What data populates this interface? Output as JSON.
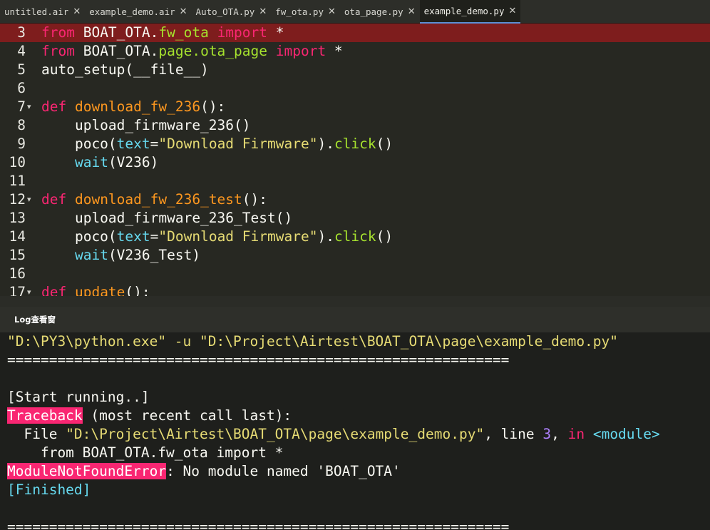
{
  "tabs": [
    {
      "label": "untitled.air",
      "active": false
    },
    {
      "label": "example_demo.air",
      "active": false
    },
    {
      "label": "Auto_OTA.py",
      "active": false
    },
    {
      "label": "fw_ota.py",
      "active": false
    },
    {
      "label": "ota_page.py",
      "active": false
    },
    {
      "label": "example_demo.py",
      "active": true
    }
  ],
  "close_glyph": "✕",
  "fold_glyph": "▾",
  "editor": {
    "lines": {
      "l3": {
        "num": "3",
        "t1": "from",
        "t2": " BOAT_OTA.",
        "t3": "fw_ota",
        "t4": " import",
        "t5": " *"
      },
      "l4": {
        "num": "4",
        "t1": "from",
        "t2": " BOAT_OTA.",
        "t3": "page.ota_page",
        "t4": " import",
        "t5": " *"
      },
      "l5": {
        "num": "5",
        "t1": "auto_setup(__file__)"
      },
      "l6": {
        "num": "6"
      },
      "l7": {
        "num": "7",
        "t1": "def",
        "t2": " download_fw_236",
        "t3": "():"
      },
      "l8": {
        "num": "8",
        "t1": "    upload_firmware_236()"
      },
      "l9": {
        "num": "9",
        "t1": "    poco(",
        "t2": "text",
        "t3": "=",
        "t4": "\"Download Firmware\"",
        "t5": ").",
        "t6": "click",
        "t7": "()"
      },
      "l10": {
        "num": "10",
        "t1": "    ",
        "t2": "wait",
        "t3": "(V236)"
      },
      "l11": {
        "num": "11"
      },
      "l12": {
        "num": "12",
        "t1": "def",
        "t2": " download_fw_236_test",
        "t3": "():"
      },
      "l13": {
        "num": "13",
        "t1": "    upload_firmware_236_Test()"
      },
      "l14": {
        "num": "14",
        "t1": "    poco(",
        "t2": "text",
        "t3": "=",
        "t4": "\"Download Firmware\"",
        "t5": ").",
        "t6": "click",
        "t7": "()"
      },
      "l15": {
        "num": "15",
        "t1": "    ",
        "t2": "wait",
        "t3": "(V236_Test)"
      },
      "l16": {
        "num": "16"
      },
      "l17": {
        "num": "17",
        "t1": "def",
        "t2": " update",
        "t3": "():"
      }
    }
  },
  "log_panel": {
    "title": "Log查看窗",
    "lines": {
      "cmd": "\"D:\\PY3\\python.exe\" -u \"D:\\Project\\Airtest\\BOAT_OTA\\page\\example_demo.py\"",
      "sep": "============================================================",
      "start": "[Start running..]",
      "tb_label": "Traceback",
      "tb_rest": " (most recent call last):",
      "file_pre": "  File ",
      "file_path": "\"D:\\Project\\Airtest\\BOAT_OTA\\page\\example_demo.py\"",
      "file_mid": ", line ",
      "file_line": "3",
      "file_comma": ", ",
      "file_in": "in",
      "file_mod": " <module>",
      "src": "    from BOAT_OTA.fw_ota import *",
      "err_label": "ModuleNotFoundError",
      "err_rest": ": No module named 'BOAT_OTA'",
      "finished": "[Finished]",
      "sep2": "============================================================"
    }
  },
  "colors": {
    "keyword": "#f92672",
    "function": "#fd971f",
    "module": "#a6e22e",
    "builtin": "#66d9ef",
    "string": "#e6db74",
    "error_highlight": "#7e1d1d",
    "active_tab_underline": "#5a8fd6"
  }
}
